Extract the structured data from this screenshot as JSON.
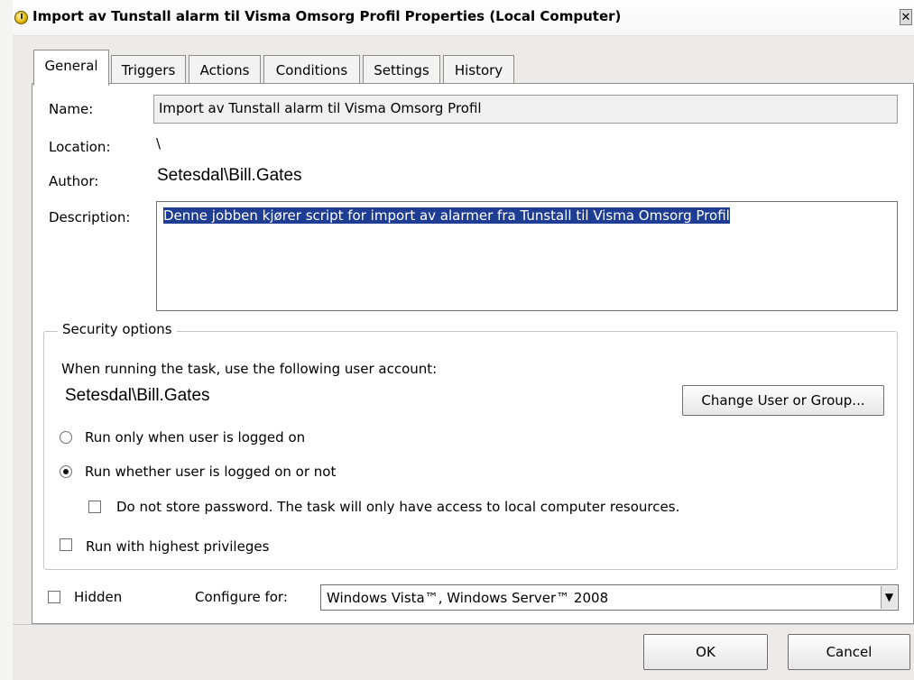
{
  "window": {
    "title": "Import av Tunstall alarm til Visma Omsorg Profil Properties (Local Computer)",
    "close_glyph": "✕"
  },
  "tabs": [
    {
      "label": "General",
      "active": true
    },
    {
      "label": "Triggers",
      "active": false
    },
    {
      "label": "Actions",
      "active": false
    },
    {
      "label": "Conditions",
      "active": false
    },
    {
      "label": "Settings",
      "active": false
    },
    {
      "label": "History",
      "active": false
    }
  ],
  "general": {
    "name_label": "Name:",
    "name_value": "Import av Tunstall alarm til Visma Omsorg Profil",
    "location_label": "Location:",
    "location_value": "\\",
    "author_label": "Author:",
    "author_value": "Setesdal\\Bill.Gates",
    "description_label": "Description:",
    "description_value": "Denne jobben kjører script for import av alarmer fra Tunstall til Visma Omsorg Profil"
  },
  "security": {
    "group_label": "Security options",
    "account_prompt": "When running the task, use the following user account:",
    "account_value": "Setesdal\\Bill.Gates",
    "change_button": "Change User or Group...",
    "radio_logged_on": {
      "label": "Run only when user is logged on",
      "selected": false
    },
    "radio_whether": {
      "label": "Run whether user is logged on or not",
      "selected": true
    },
    "check_no_password": {
      "label": "Do not store password.  The task will only have access to local computer resources.",
      "checked": false
    },
    "check_highest": {
      "label": "Run with highest privileges",
      "checked": false
    }
  },
  "bottom": {
    "hidden_label": "Hidden",
    "hidden_checked": false,
    "configure_label": "Configure for:",
    "configure_value": "Windows Vista™, Windows Server™ 2008",
    "ok_button": "OK",
    "cancel_button": "Cancel"
  },
  "colors": {
    "selection": "#1f3e93",
    "dialog_bg": "#ecebe8"
  }
}
